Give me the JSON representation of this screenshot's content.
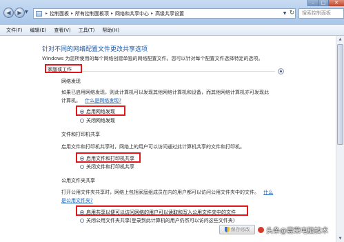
{
  "address": {
    "crumbs": [
      "控制面板",
      "所有控制面板项",
      "网络和共享中心",
      "高级共享设置"
    ],
    "search_placeholder": "搜索控制面板"
  },
  "menu": [
    "文件(F)",
    "编辑(E)",
    "查看(V)",
    "工具(T)",
    "帮助(H)"
  ],
  "page": {
    "heading": "针对不同的网络配置文件更改共享选项",
    "intro": "Windows 为您所使用的每个网络创建单独的网络配置文件。您可以针对每个配置文件选择特定的选项。",
    "group_title": "家庭或工作"
  },
  "sections": {
    "discovery": {
      "title": "网络发现",
      "desc1": "如果已启用网络发现，则此计算机可以发现其他网络计算机和设备，而其他网络计算机亦可发现此",
      "desc2": "计算机。",
      "link": "什么是网络发现?",
      "opt_on": "启用网络发现",
      "opt_off": "关闭网络发现"
    },
    "file_printer": {
      "title": "文件和打印机共享",
      "desc": "启用文件和打印机共享时，网络上的用户可以访问通过此计算机共享的文件和打印机。",
      "opt_on": "启用文件和打印机共享",
      "opt_off": "关闭文件和打印机共享"
    },
    "public_folder": {
      "title": "公用文件夹共享",
      "desc1": "打开公用文件夹共享时，网络上包括家庭组成员在内的用户都可以访问公用文件夹中的文件。",
      "link_a": "什么",
      "link_b": "是公用文件夹?",
      "opt_on": "启用共享以便可以访问网络的用户可以读取和写入公用文件夹中的文件",
      "opt_off": "关闭公用文件夹共享(登录到此计算机的用户仍然可以访问这些文件夹)"
    }
  },
  "save_button": "保存修改",
  "watermark": "头条@壹荣电脑技术",
  "colors": {
    "heading": "#1d5aa8",
    "highlight": "#e1151a",
    "link": "#1c5fb4"
  }
}
